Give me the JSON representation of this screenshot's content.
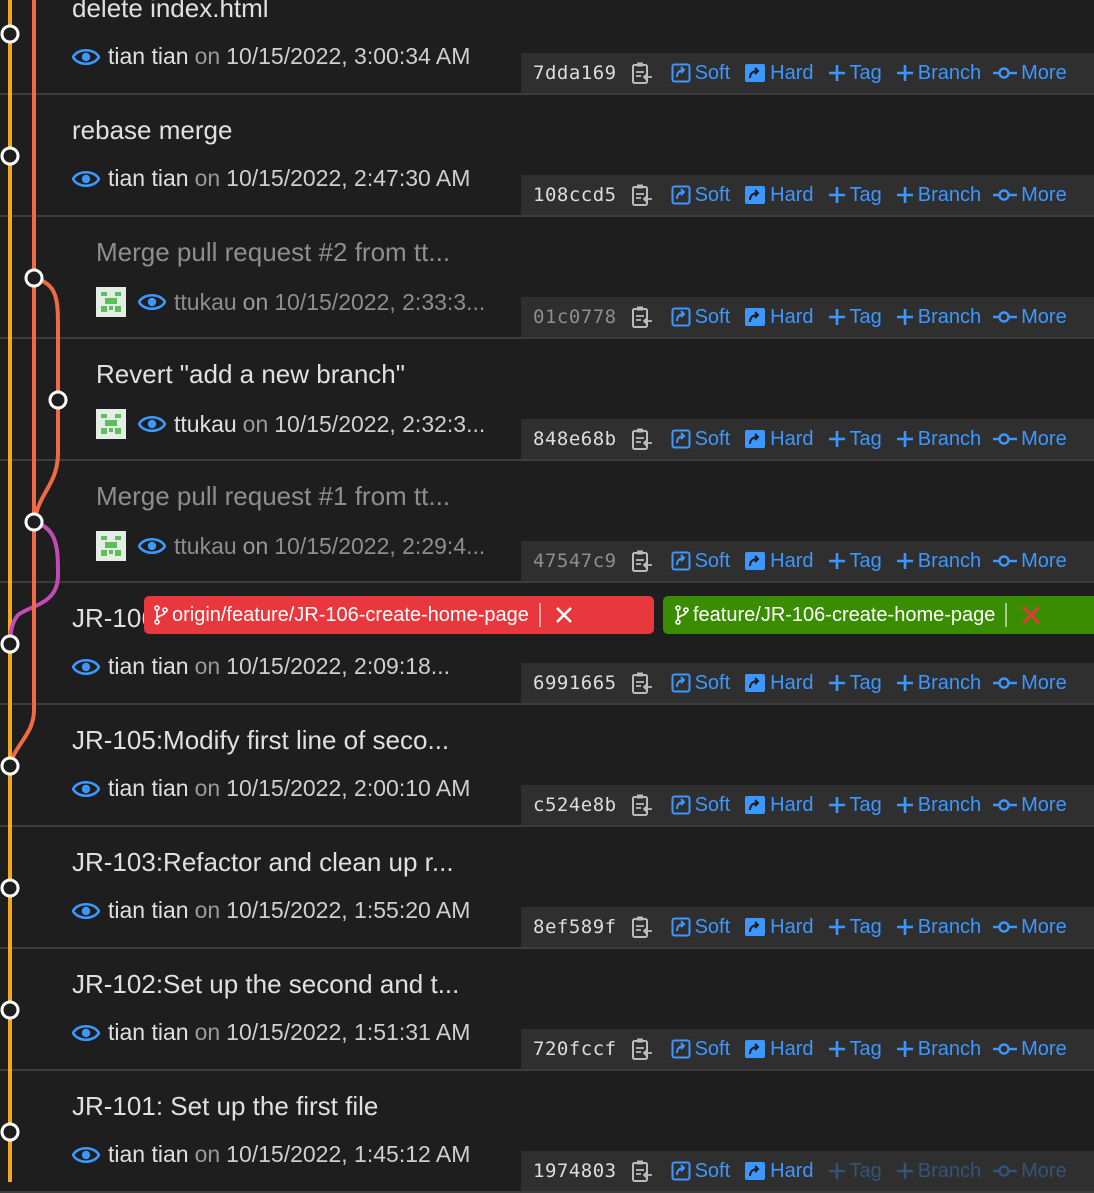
{
  "colors": {
    "background": "#1e1e1e",
    "accent_blue": "#3c98ff",
    "graph_orange": "#f5a623",
    "graph_coral": "#f06a46",
    "graph_magenta": "#c24bb5",
    "remote_badge": "#e8383d",
    "local_badge": "#3a8c00"
  },
  "actions": {
    "soft": "Soft",
    "hard": "Hard",
    "tag": "Tag",
    "branch": "Branch",
    "more": "More"
  },
  "on_word": "on",
  "commits": [
    {
      "subject": "delete index.html",
      "author": "tian tian",
      "date": "10/15/2022, 3:00:34 AM",
      "hash": "7dda169",
      "avatar": false,
      "dim": false
    },
    {
      "subject": "rebase merge",
      "author": "tian tian",
      "date": "10/15/2022, 2:47:30 AM",
      "hash": "108ccd5",
      "avatar": false,
      "dim": false
    },
    {
      "subject": "Merge pull request #2 from tt...",
      "author": "ttukau",
      "date": "10/15/2022, 2:33:3...",
      "hash": "01c0778",
      "avatar": true,
      "dim": true
    },
    {
      "subject": "Revert \"add a new branch\"",
      "author": "ttukau",
      "date": "10/15/2022, 2:32:3...",
      "hash": "848e68b",
      "avatar": true,
      "dim": false
    },
    {
      "subject": "Merge pull request #1 from tt...",
      "author": "ttukau",
      "date": "10/15/2022, 2:29:4...",
      "hash": "47547c9",
      "avatar": true,
      "dim": true
    },
    {
      "subject": "JR-106:Create the home pa...",
      "author": "tian tian",
      "date": "10/15/2022, 2:09:18...",
      "hash": "6991665",
      "avatar": false,
      "dim": false,
      "refs": {
        "remote": "origin/feature/JR-106-create-home-page",
        "local": "feature/JR-106-create-home-page"
      }
    },
    {
      "subject": "JR-105:Modify first line of seco...",
      "author": "tian tian",
      "date": "10/15/2022, 2:00:10 AM",
      "hash": "c524e8b",
      "avatar": false,
      "dim": false
    },
    {
      "subject": "JR-103:Refactor and clean up r...",
      "author": "tian tian",
      "date": "10/15/2022, 1:55:20 AM",
      "hash": "8ef589f",
      "avatar": false,
      "dim": false
    },
    {
      "subject": "JR-102:Set up the second and t...",
      "author": "tian tian",
      "date": "10/15/2022, 1:51:31 AM",
      "hash": "720fccf",
      "avatar": false,
      "dim": false
    },
    {
      "subject": "JR-101: Set up the first file",
      "author": "tian tian",
      "date": "10/15/2022, 1:45:12 AM",
      "hash": "1974803",
      "avatar": false,
      "dim": false
    }
  ]
}
